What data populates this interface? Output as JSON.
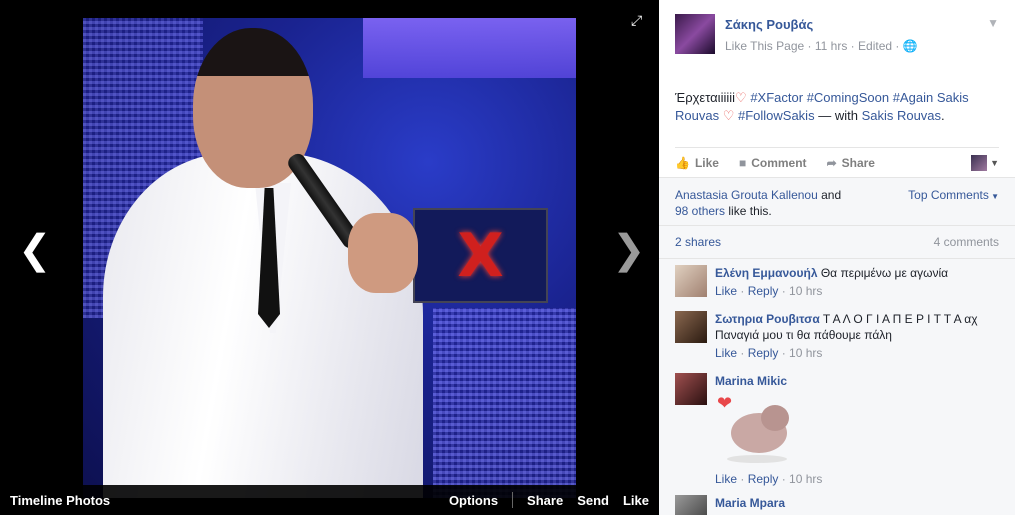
{
  "viewer": {
    "album_label": "Timeline Photos",
    "actions": [
      "Options",
      "Share",
      "Send",
      "Like"
    ],
    "logo_letter": "X"
  },
  "post": {
    "page_name": "Σάκης Ρουβάς",
    "like_page": "Like This Page",
    "time": "11 hrs",
    "edited": "Edited",
    "text_prefix": "Έρχεται",
    "text_ii": "iiiii",
    "tags": [
      "#XFactor",
      "#ComingSoon",
      "#Again"
    ],
    "tag_person": "Sakis Rouvas",
    "tag_follow": "#FollowSakis",
    "with_text": "— with",
    "with_person": "Sakis Rouvas",
    "actions": {
      "like": "Like",
      "comment": "Comment",
      "share": "Share"
    }
  },
  "ufi": {
    "liker": "Anastasia Grouta Kallenou",
    "and": "and",
    "others": "98 others",
    "like_this": "like this.",
    "top_comments": "Top Comments",
    "shares": "2 shares",
    "comments_count": "4 comments"
  },
  "comments": [
    {
      "author": "Ελένη Εμμανουήλ",
      "text": "Θα περιμένω με αγωνία",
      "like": "Like",
      "reply": "Reply",
      "time": "10 hrs",
      "avatar_color": "#c8b8a0"
    },
    {
      "author": "Σωτηρια Ρουβιτσα",
      "text": "Τ Α Λ Ο Γ Ι Α Π Ε Ρ Ι Τ Τ Α αχ Παναγιά μου τι θα πάθουμε πάλη",
      "like": "Like",
      "reply": "Reply",
      "time": "10 hrs",
      "avatar_color": "#6a5040"
    },
    {
      "author": "Marina Mikic",
      "text": "",
      "like": "Like",
      "reply": "Reply",
      "time": "10 hrs",
      "avatar_color": "#7a3a3a"
    },
    {
      "author": "Maria Mpara",
      "avatar_color": "#5a5a5a"
    }
  ]
}
